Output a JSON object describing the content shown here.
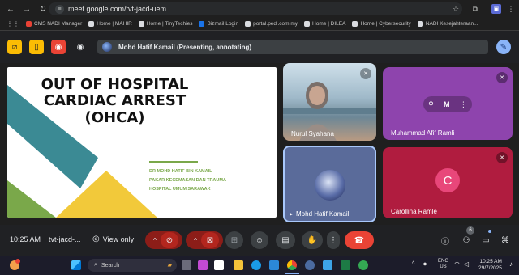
{
  "browser": {
    "url": "meet.google.com/tvt-jacd-uem",
    "bookmarks": [
      {
        "label": "CMS NADI Manager",
        "color": "#e94235"
      },
      {
        "label": "Home | MAHIR",
        "color": "#dadce0"
      },
      {
        "label": "Home | TinyTechies",
        "color": "#dadce0"
      },
      {
        "label": "Bizmail Login",
        "color": "#1a73e8"
      },
      {
        "label": "portal.pedi.com.my",
        "color": "#dadce0"
      },
      {
        "label": "Home | DILEA",
        "color": "#dadce0"
      },
      {
        "label": "Home | Cybersecurity",
        "color": "#dadce0"
      },
      {
        "label": "NADI Kesejahteraan...",
        "color": "#dadce0"
      }
    ]
  },
  "meet": {
    "presenter_banner": "Mohd Hatif Kamail (Presenting, annotating)",
    "slide": {
      "title_line1": "OUT OF HOSPITAL",
      "title_line2": "CARDIAC ARREST",
      "title_line3": "(OHCA)",
      "author_line1": "DR MOHD HATIF BIN KAMAIL",
      "author_line2": "PAKAR KECEMASAN DAN TRAUMA",
      "author_line3": "HOSPITAL UMUM SARAWAK"
    },
    "participants": [
      {
        "name": "Nurul Syahana"
      },
      {
        "name": "Muhammad Afif Ramli",
        "initial_logo": "M"
      },
      {
        "name": "Mohd Hatif Kamail"
      },
      {
        "name": "Carollina Ramle",
        "initial": "C"
      }
    ],
    "bottom": {
      "time": "10:25 AM",
      "meeting_code": "tvt-jacd-...",
      "view_only": "View only",
      "people_count": "6"
    }
  },
  "taskbar": {
    "search_placeholder": "Search",
    "lang_line1": "ENG",
    "lang_line2": "US",
    "clock_time": "10:25 AM",
    "clock_date": "29/7/2025"
  },
  "colors": {
    "leave_red": "#ea4335",
    "mic_off_red": "#8c1d18",
    "afif_tile": "#8e44ad",
    "carollina_tile": "#b01c3f",
    "slide_teal": "#3b8a94",
    "slide_green": "#7aa84a",
    "slide_yellow": "#f2c93a"
  }
}
